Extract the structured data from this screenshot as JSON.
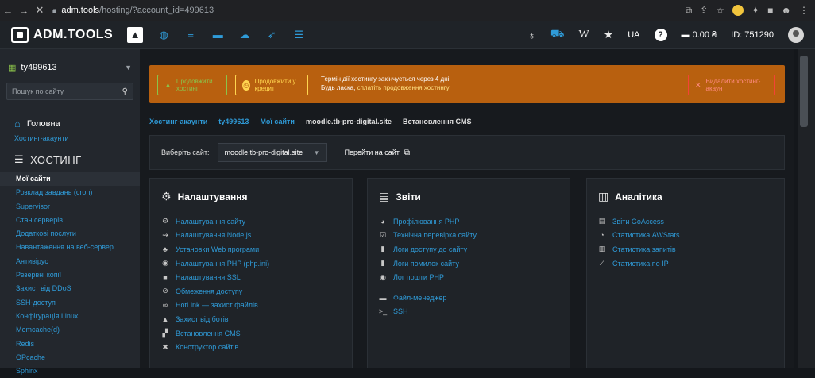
{
  "browser": {
    "url_host": "adm.tools",
    "url_path": "/hosting/?account_id=499613"
  },
  "topnav": {
    "logo": "ADM.TOOLS",
    "services": [
      "hosting-icon",
      "globe-icon",
      "servers-icon",
      "vps-icon",
      "cloud-icon",
      "rocket-icon",
      "database-icon"
    ],
    "lang": "UA",
    "balance": "0.00 ₴",
    "user_id": "ID: 751290"
  },
  "sidebar": {
    "account": "ty499613",
    "search_placeholder": "Пошук по сайту",
    "home": "Головна",
    "hosting_accounts": "Хостинг-акаунти",
    "section": "ХОСТИНГ",
    "items": [
      "Мої сайти",
      "Розклад завдань (cron)",
      "Supervisor",
      "Стан серверів",
      "Додаткові послуги",
      "Навантаження на веб-сервер",
      "Антивірус",
      "Резервні копії",
      "Захист від DDoS",
      "SSH-доступ",
      "Конфігурація Linux",
      "Memcache(d)",
      "Redis",
      "OPcache",
      "Sphinx"
    ]
  },
  "alert": {
    "extend_label": "Продовжити хостинг",
    "credit_label": "Продовжити у кредит",
    "line1": "Термін дії хостингу закінчується через 4 дні",
    "line2_prefix": "Будь ласка, ",
    "line2_link": "сплатіть продовження хостингу",
    "delete_label": "Видалити хостинг-акаунт"
  },
  "breadcrumb": [
    "Хостинг-акаунти",
    "ty499613",
    "Мої сайти",
    "moodle.tb-pro-digital.site",
    "Встановлення CMS"
  ],
  "site_bar": {
    "label": "Виберіть сайт:",
    "selected": "moodle.tb-pro-digital.site",
    "goto": "Перейти на сайт"
  },
  "cards": {
    "settings": {
      "title": "Налаштування",
      "items": [
        "Налаштування сайту",
        "Налаштування Node.js",
        "Установки Web програми",
        "Налаштування PHP (php.ini)",
        "Налаштування SSL",
        "Обмеження доступу",
        "HotLink — захист файлів",
        "Захист від ботів",
        "Встановлення CMS",
        "Конструктор сайтів"
      ]
    },
    "reports": {
      "title": "Звіти",
      "items": [
        "Профілювання PHP",
        "Технічна перевірка сайту",
        "Логи доступу до сайту",
        "Логи помилок сайту",
        "Лог пошти PHP"
      ],
      "items2": [
        "Файл-менеджер",
        "SSH"
      ]
    },
    "analytics": {
      "title": "Аналітика",
      "items": [
        "Звіти GoAccess",
        "Статистика AWStats",
        "Статистика запитів",
        "Статистика по IP"
      ]
    }
  }
}
